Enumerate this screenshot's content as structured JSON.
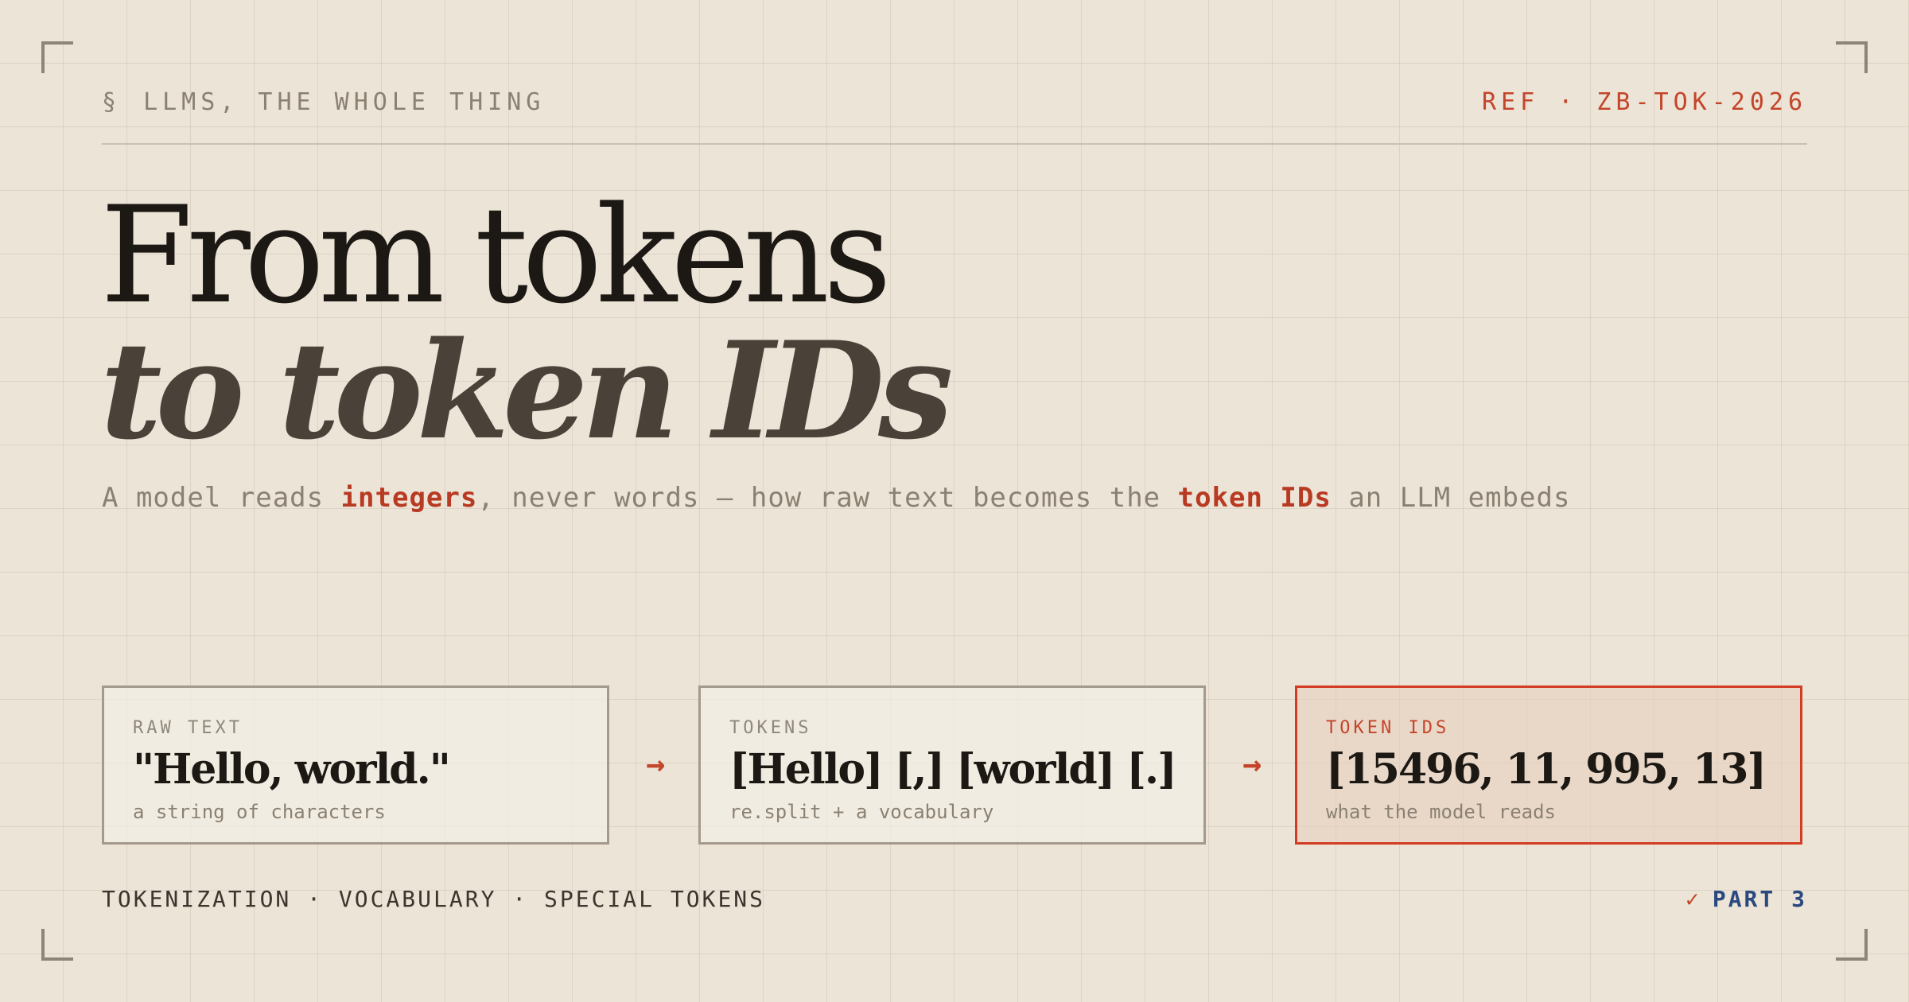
{
  "header": {
    "section_symbol": "§",
    "kicker": "LLMS, THE WHOLE THING",
    "ref": "REF · ZB-TOK-2026"
  },
  "title": {
    "line1": "From tokens",
    "line2": "to token IDs"
  },
  "subtitle": {
    "part1": "A model reads ",
    "highlight1": "integers",
    "part2": ", never words — how raw text becomes the ",
    "highlight2": "token IDs",
    "part3": " an LLM embeds"
  },
  "pipeline": [
    {
      "label": "RAW TEXT",
      "value": "\"Hello, world.\"",
      "note": "a string of characters"
    },
    {
      "label": "TOKENS",
      "value": "[Hello] [,] [world] [.]",
      "note": "re.split + a vocabulary"
    },
    {
      "label": "TOKEN IDS",
      "value": "[15496, 11, 995, 13]",
      "note": "what the model reads"
    }
  ],
  "arrows": [
    "→",
    "→"
  ],
  "footer": {
    "topics": "TOKENIZATION · VOCABULARY · SPECIAL TOKENS",
    "check": "✓",
    "part": "PART 3"
  },
  "colors": {
    "background": "#ece4d7",
    "accent": "#c4452a",
    "part_blue": "#2a4a7f"
  }
}
